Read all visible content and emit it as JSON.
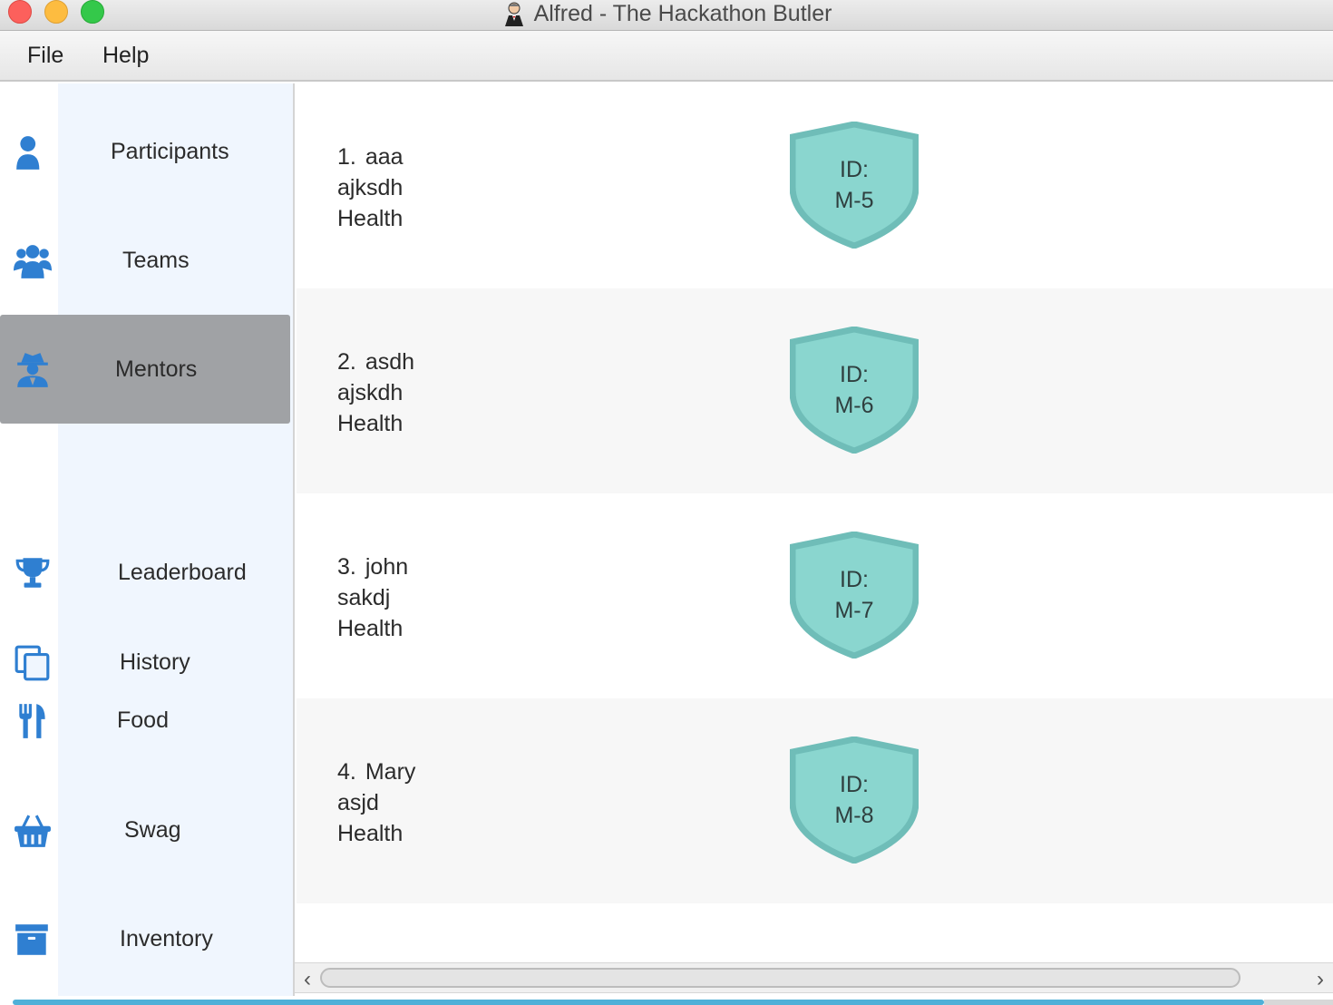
{
  "window": {
    "title": "Alfred - The Hackathon Butler"
  },
  "menubar": {
    "file": "File",
    "help": "Help"
  },
  "sidebar": {
    "items": [
      {
        "label": "Participants",
        "icon": "user-icon",
        "selected": false
      },
      {
        "label": "Teams",
        "icon": "users-icon",
        "selected": false
      },
      {
        "label": "Mentors",
        "icon": "user-secret-icon",
        "selected": true
      },
      {
        "label": "Leaderboard",
        "icon": "trophy-icon",
        "selected": false
      },
      {
        "label": "History",
        "icon": "copy-icon",
        "selected": false
      },
      {
        "label": "Food",
        "icon": "utensils-icon",
        "selected": false
      },
      {
        "label": "Swag",
        "icon": "basket-icon",
        "selected": false
      },
      {
        "label": "Inventory",
        "icon": "archive-icon",
        "selected": false
      }
    ]
  },
  "mentors": [
    {
      "index": "1.",
      "name": "aaa",
      "organization": "ajksdh",
      "specialisation": "Health",
      "id_label": "ID:",
      "id": "M-5"
    },
    {
      "index": "2.",
      "name": "asdh",
      "organization": "ajskdh",
      "specialisation": "Health",
      "id_label": "ID:",
      "id": "M-6"
    },
    {
      "index": "3.",
      "name": "john",
      "organization": "sakdj",
      "specialisation": "Health",
      "id_label": "ID:",
      "id": "M-7"
    },
    {
      "index": "4.",
      "name": "Mary",
      "organization": "asjd",
      "specialisation": "Health",
      "id_label": "ID:",
      "id": "M-8"
    }
  ],
  "colors": {
    "accent_icon": "#2f7fd1",
    "sidebar_bg": "#f0f6fe",
    "selected_bg": "#a0a2a5",
    "badge_fill": "#8ad6cf",
    "badge_border": "#6fbdb8"
  }
}
